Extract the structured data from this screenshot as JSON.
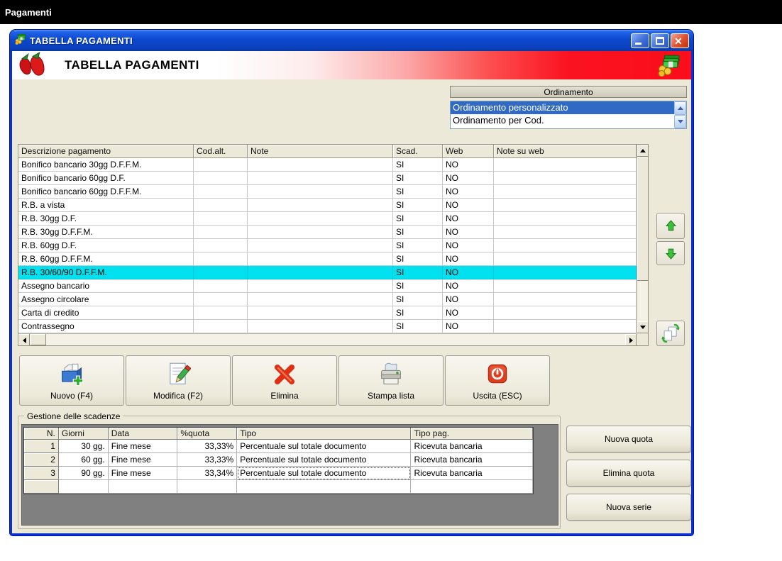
{
  "topbar": {
    "title": "Pagamenti"
  },
  "window": {
    "title": "TABELLA PAGAMENTI",
    "header_title": "TABELLA PAGAMENTI"
  },
  "ordinamento": {
    "label": "Ordinamento",
    "options": [
      {
        "label": "Ordinamento personalizzato",
        "selected": true
      },
      {
        "label": "Ordinamento per Cod.",
        "selected": false
      }
    ]
  },
  "payments_table": {
    "columns": [
      "Descrizione pagamento",
      "Cod.alt.",
      "Note",
      "Scad.",
      "Web",
      "Note su web"
    ],
    "rows": [
      {
        "descrizione": "Bonifico bancario 30gg D.F.F.M.",
        "cod_alt": "",
        "note": "",
        "scad": "SI",
        "web": "NO",
        "note_su_web": "",
        "selected": false
      },
      {
        "descrizione": "Bonifico bancario 60gg D.F.",
        "cod_alt": "",
        "note": "",
        "scad": "SI",
        "web": "NO",
        "note_su_web": "",
        "selected": false
      },
      {
        "descrizione": "Bonifico bancario 60gg D.F.F.M.",
        "cod_alt": "",
        "note": "",
        "scad": "SI",
        "web": "NO",
        "note_su_web": "",
        "selected": false
      },
      {
        "descrizione": "R.B. a vista",
        "cod_alt": "",
        "note": "",
        "scad": "SI",
        "web": "NO",
        "note_su_web": "",
        "selected": false
      },
      {
        "descrizione": "R.B. 30gg D.F.",
        "cod_alt": "",
        "note": "",
        "scad": "SI",
        "web": "NO",
        "note_su_web": "",
        "selected": false
      },
      {
        "descrizione": "R.B. 30gg D.F.F.M.",
        "cod_alt": "",
        "note": "",
        "scad": "SI",
        "web": "NO",
        "note_su_web": "",
        "selected": false
      },
      {
        "descrizione": "R.B. 60gg D.F.",
        "cod_alt": "",
        "note": "",
        "scad": "SI",
        "web": "NO",
        "note_su_web": "",
        "selected": false
      },
      {
        "descrizione": "R.B. 60gg D.F.F.M.",
        "cod_alt": "",
        "note": "",
        "scad": "SI",
        "web": "NO",
        "note_su_web": "",
        "selected": false
      },
      {
        "descrizione": "R.B. 30/60/90 D.F.F.M.",
        "cod_alt": "",
        "note": "",
        "scad": "SI",
        "web": "NO",
        "note_su_web": "",
        "selected": true
      },
      {
        "descrizione": "Assegno bancario",
        "cod_alt": "",
        "note": "",
        "scad": "SI",
        "web": "NO",
        "note_su_web": "",
        "selected": false
      },
      {
        "descrizione": "Assegno circolare",
        "cod_alt": "",
        "note": "",
        "scad": "SI",
        "web": "NO",
        "note_su_web": "",
        "selected": false
      },
      {
        "descrizione": "Carta di credito",
        "cod_alt": "",
        "note": "",
        "scad": "SI",
        "web": "NO",
        "note_su_web": "",
        "selected": false
      },
      {
        "descrizione": "Contrassegno",
        "cod_alt": "",
        "note": "",
        "scad": "SI",
        "web": "NO",
        "note_su_web": "",
        "selected": false
      }
    ]
  },
  "actions": {
    "nuovo": "Nuovo (F4)",
    "modifica": "Modifica (F2)",
    "elimina": "Elimina",
    "stampa": "Stampa lista",
    "uscita": "Uscita (ESC)"
  },
  "scadenze": {
    "group_label": "Gestione delle scadenze",
    "columns": [
      "N.",
      "Giorni",
      "Data",
      "%quota",
      "Tipo",
      "Tipo pag."
    ],
    "rows": [
      {
        "n": "1",
        "giorni": "30 gg.",
        "data": "Fine mese",
        "quota": "33,33%",
        "tipo": "Percentuale sul totale documento",
        "tipo_pag": "Ricevuta bancaria"
      },
      {
        "n": "2",
        "giorni": "60 gg.",
        "data": "Fine mese",
        "quota": "33,33%",
        "tipo": "Percentuale sul totale documento",
        "tipo_pag": "Ricevuta bancaria"
      },
      {
        "n": "3",
        "giorni": "90 gg.",
        "data": "Fine mese",
        "quota": "33,34%",
        "tipo": "Percentuale sul totale documento",
        "tipo_pag": "Ricevuta bancaria",
        "focus_col": "tipo"
      },
      {
        "n": "",
        "giorni": "",
        "data": "",
        "quota": "",
        "tipo": "",
        "tipo_pag": ""
      }
    ],
    "buttons": {
      "nuova_quota": "Nuova quota",
      "elimina_quota": "Elimina quota",
      "nuova_serie": "Nuova serie"
    }
  },
  "colors": {
    "selection_blue": "#316AC5",
    "highlight_cyan": "#00E0EE",
    "titlebar_blue": "#0C48D0",
    "header_red": "#FB0D1B",
    "body_beige": "#ECE9D8",
    "panel_gray": "#808080",
    "arrow_green": "#3DBE3D"
  }
}
